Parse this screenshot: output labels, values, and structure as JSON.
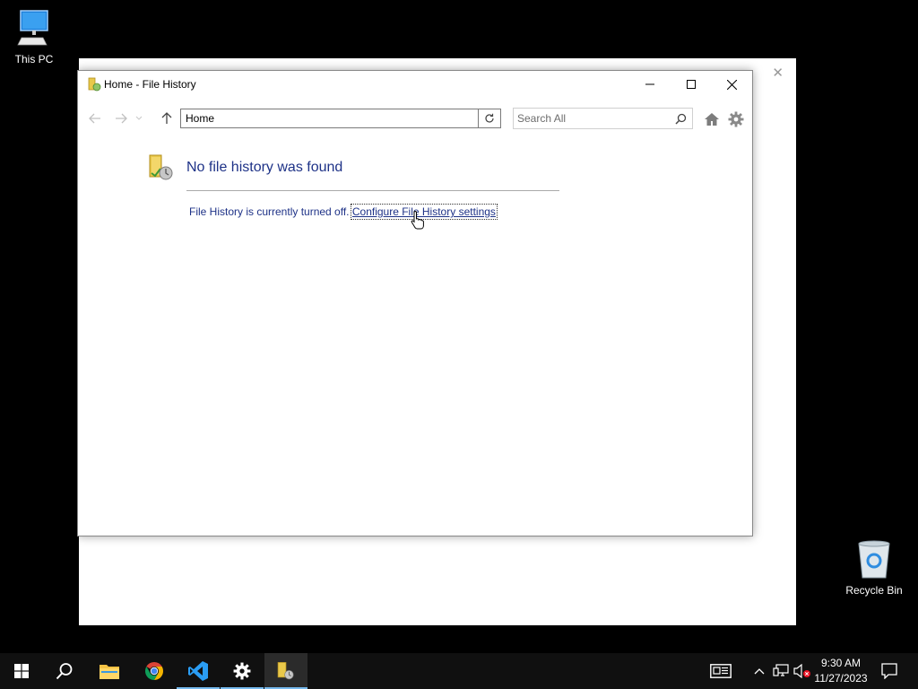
{
  "desktop": {
    "icons": {
      "this_pc": "This PC",
      "recycle_bin": "Recycle Bin"
    }
  },
  "window": {
    "title": "Home - File History",
    "address": "Home",
    "search_placeholder": "Search All",
    "heading": "No file history was found",
    "status_text": "File History is currently turned off.",
    "link_text": "Configure File History settings"
  },
  "taskbar": {
    "apps": [
      "start-icon",
      "search-icon",
      "file-explorer-icon",
      "chrome-icon",
      "vscode-icon",
      "settings-icon",
      "file-history-icon"
    ],
    "time": "9:30 AM",
    "date": "11/27/2023"
  },
  "colors": {
    "link": "#1e3287",
    "taskbar": "#101010",
    "accent": "#76b9ed"
  }
}
